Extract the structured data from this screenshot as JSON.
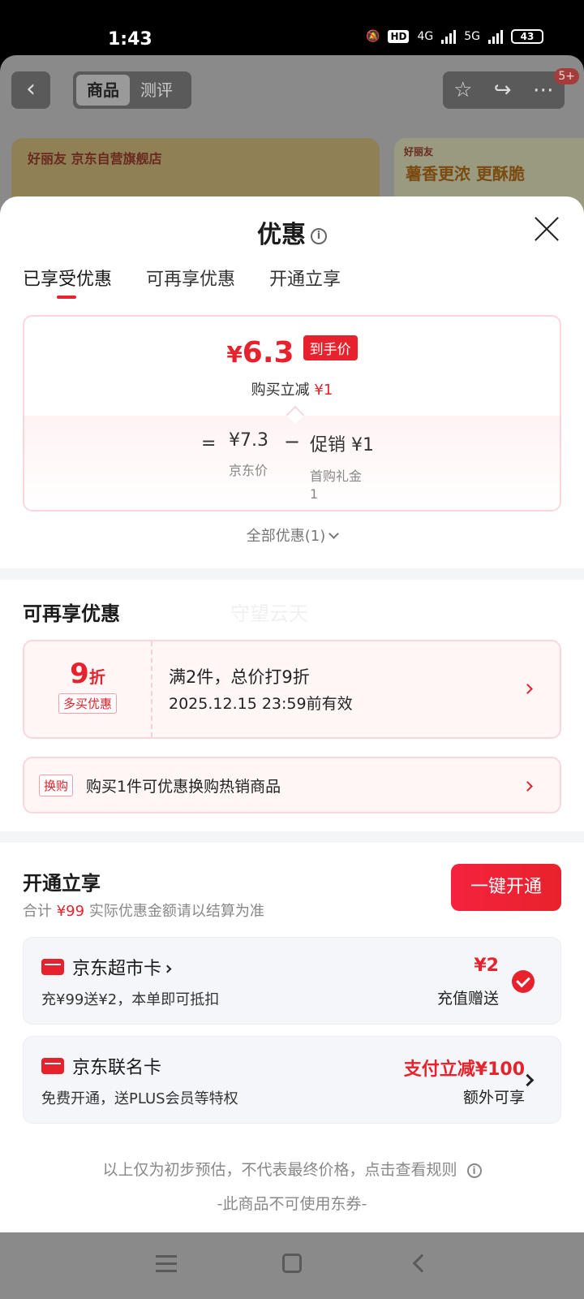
{
  "status_bar": {
    "time": "1:43",
    "network1": "4G",
    "network2": "5G",
    "battery": "43",
    "hd": "HD"
  },
  "background_page": {
    "tabs": [
      "商品",
      "测评"
    ],
    "badge": "5+",
    "banner_brand": "好丽友 京东自营旗舰店",
    "banner2_brand": "好丽友",
    "banner2_slogan": "薯香更浓 更酥脆"
  },
  "sheet": {
    "title": "优惠",
    "tabs": [
      "已享受优惠",
      "可再享优惠",
      "开通立享"
    ],
    "price_card": {
      "currency": "¥",
      "final_price": "6.3",
      "final_tag": "到手价",
      "reduction_label": "购买立减",
      "reduction_value": "¥1",
      "eq": "=",
      "jd_price": "¥7.3",
      "jd_price_label": "京东价",
      "minus": "−",
      "promo": "促销 ¥1",
      "promo_label": "首购礼金",
      "promo_count": "1"
    },
    "all_discounts": "全部优惠(1)"
  },
  "more_discounts": {
    "title": "可再享优惠",
    "watermark": "守望云天",
    "coupon": {
      "value": "9",
      "unit": "折",
      "label": "多买优惠",
      "line1": "满2件，总价打9折",
      "line2": "2025.12.15 23:59前有效"
    },
    "swap": {
      "badge": "换购",
      "text": "购买1件可优惠换购热销商品"
    }
  },
  "open_section": {
    "title": "开通立享",
    "sub_prefix": "合计",
    "sub_amount": "¥99",
    "sub_suffix": "实际优惠金额请以结算为准",
    "button": "一键开通",
    "cards": [
      {
        "title": "京东超市卡",
        "desc": "充¥99送¥2，本单即可抵扣",
        "value": "¥2",
        "sub": "充值赠送",
        "checked": true
      },
      {
        "title": "京东联名卡",
        "desc": "免费开通，送PLUS会员等特权",
        "value": "支付立减¥100",
        "sub": "额外可享",
        "checked": false
      }
    ]
  },
  "footnotes": {
    "line1": "以上仅为初步预估，不代表最终价格，点击查看规则",
    "line2": "-此商品不可使用东券-"
  },
  "colors": {
    "accent": "#e8222c",
    "card_bg": "#f5f6f9",
    "pink_border": "#fbd7dc"
  },
  "icons": [
    "back-icon",
    "star-icon",
    "share-icon",
    "more-icon",
    "info-icon",
    "close-icon",
    "chevron-down-icon",
    "chevron-right-icon",
    "card-icon",
    "check-icon",
    "nav-menu-icon",
    "nav-home-icon",
    "nav-back-icon"
  ]
}
